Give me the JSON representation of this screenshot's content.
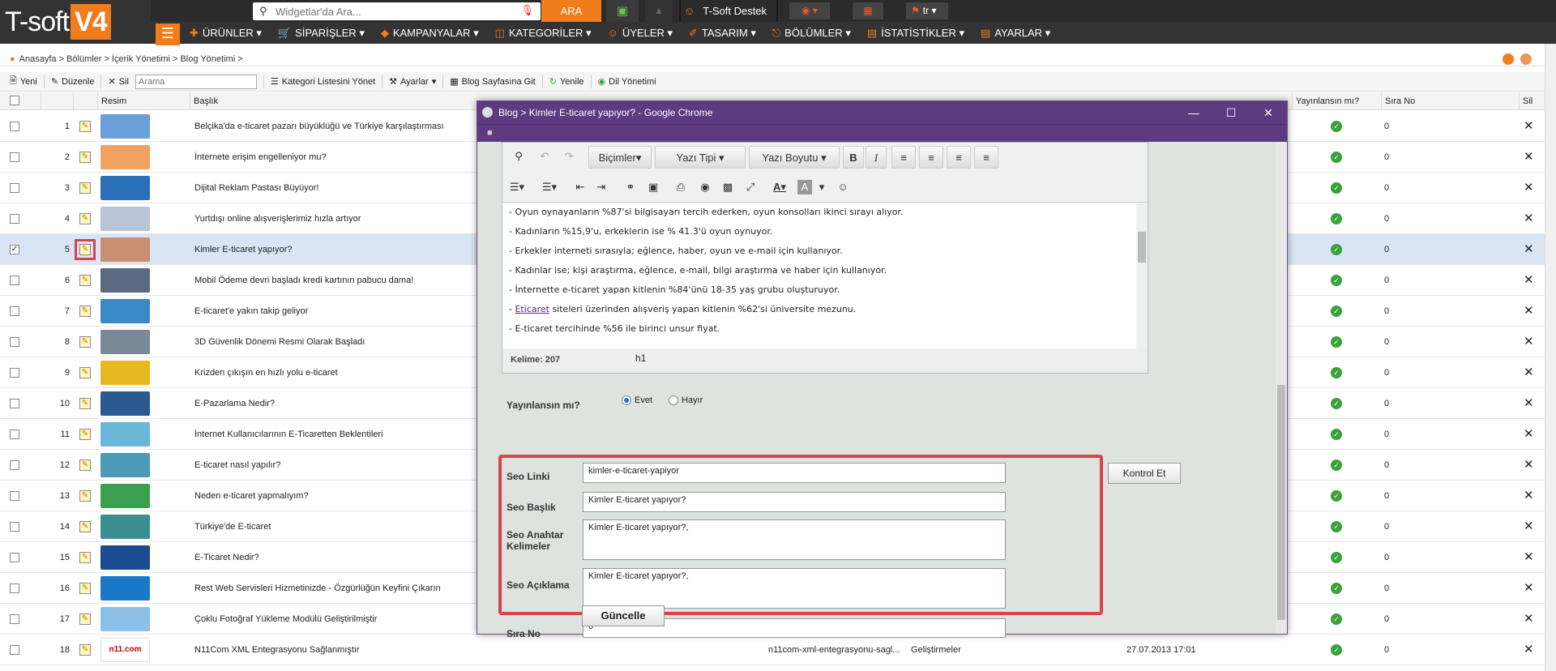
{
  "header": {
    "logo_text": "T-soft",
    "logo_version": "V4",
    "search_placeholder": "Widgetlar'da Ara...",
    "search_button": "ARA",
    "support_label": "T-Soft Destek",
    "language": "tr"
  },
  "nav": {
    "items": [
      {
        "label": "ÜRÜNLER",
        "icon": "plus-icon"
      },
      {
        "label": "SİPARİŞLER",
        "icon": "cart-icon"
      },
      {
        "label": "KAMPANYALAR",
        "icon": "tag-icon"
      },
      {
        "label": "KATEGORİLER",
        "icon": "tree-icon"
      },
      {
        "label": "ÜYELER",
        "icon": "users-icon"
      },
      {
        "label": "TASARIM",
        "icon": "brush-icon"
      },
      {
        "label": "BÖLÜMLER",
        "icon": "sitemap-icon"
      },
      {
        "label": "İSTATİSTİKLER",
        "icon": "chart-icon"
      },
      {
        "label": "AYARLAR",
        "icon": "settings-icon"
      }
    ]
  },
  "breadcrumb": "Anasayfa > Bölümler > İçerik Yönetimi > Blog Yönetimi >",
  "toolbar": {
    "new": "Yeni",
    "edit": "Düzenle",
    "delete": "Sil",
    "search_placeholder": "Arama",
    "category_manage": "Kategori Listesini Yönet",
    "settings": "Ayarlar",
    "goto_blog": "Blog Sayfasına Git",
    "refresh": "Yenile",
    "language_manage": "Dil Yönetimi"
  },
  "grid": {
    "headers": {
      "image": "Resim",
      "title": "Başlık",
      "published": "Yayınlansın mı?",
      "order": "Sıra No",
      "delete": "Sil"
    },
    "rows": [
      {
        "num": "1",
        "title": "Belçika'da e-ticaret pazarı büyüklüğü ve Türkiye karşılaştırması",
        "order": "0",
        "thumb": "#6a9fd8"
      },
      {
        "num": "2",
        "title": "İnternete erişim engelleniyor mu?",
        "order": "0",
        "thumb": "#f0a060"
      },
      {
        "num": "3",
        "title": "Dijital Reklam Pastası Büyüyor!",
        "order": "0",
        "thumb": "#2a6fb8"
      },
      {
        "num": "4",
        "title": "Yurtdışı online alışverişlerimiz hızla artıyor",
        "order": "0",
        "thumb": "#b8c4d8"
      },
      {
        "num": "5",
        "title": "Kimler E-ticaret yapıyor?",
        "order": "0",
        "thumb": "#c89070",
        "selected": true
      },
      {
        "num": "6",
        "title": "Mobil Ödeme devri başladı kredi kartının pabucu dama!",
        "order": "0",
        "thumb": "#5a6a80"
      },
      {
        "num": "7",
        "title": "E-ticaret'e yakın takip geliyor",
        "order": "0",
        "thumb": "#3a8ac8"
      },
      {
        "num": "8",
        "title": "3D Güvenlik Dönemi Resmi Olarak Başladı",
        "order": "0",
        "thumb": "#7a8898"
      },
      {
        "num": "9",
        "title": "Krizden çıkışın en hızlı yolu e-ticaret",
        "order": "0",
        "thumb": "#e8b820"
      },
      {
        "num": "10",
        "title": "E-Pazarlama Nedir?",
        "order": "0",
        "thumb": "#2a5a90"
      },
      {
        "num": "11",
        "title": "İnternet Kullanıcılarının E-Ticaretten Beklentileri",
        "order": "0",
        "thumb": "#6ab8d8"
      },
      {
        "num": "12",
        "title": "E-ticaret nasıl yapılır?",
        "order": "0",
        "thumb": "#4a9ab8"
      },
      {
        "num": "13",
        "title": "Neden e-ticaret yapmalıyım?",
        "order": "0",
        "thumb": "#3aa050"
      },
      {
        "num": "14",
        "title": "Türkiye'de E-ticaret",
        "order": "0",
        "thumb": "#3a9090"
      },
      {
        "num": "15",
        "title": "E-Ticaret Nedir?",
        "order": "0",
        "thumb": "#1a4a90"
      },
      {
        "num": "16",
        "title": "Rest Web Servisleri Hizmetinizde - Özgürlüğün Keyfini Çıkarın",
        "order": "0",
        "thumb": "#1a78c8"
      },
      {
        "num": "17",
        "title": "Çoklu Fotoğraf Yükleme Modülü Geliştirilmiştir",
        "order": "0",
        "thumb": "#8ac0e8"
      },
      {
        "num": "18",
        "title": "N11Com XML Entegrasyonu Sağlanmıştır",
        "order": "0",
        "thumb": "#ffffff",
        "thumb_text": "n11.com",
        "slug": "n11com-xml-entegrasyonu-sagl...",
        "category": "Geliştirmeler",
        "date": "27.07.2013 17:01"
      }
    ]
  },
  "window": {
    "title": "Blog > Kimler E-ticaret yapıyor? - Google Chrome",
    "editor": {
      "formats_label": "Biçimler",
      "font_label": "Yazı Tipi",
      "size_label": "Yazı Boyutu",
      "lines": [
        "- Oyun oynayanların %87'si bilgisayarı tercih ederken, oyun konsolları ikinci sırayı alıyor.",
        "- Kadınların %15,9'u, erkeklerin ise % 41.3'ü oyun oynuyor.",
        "- Erkekler interneti sırasıyla; eğlence, haber, oyun ve e-mail için kullanıyor.",
        "- Kadınlar ise; kişi araştırma, eğlence, e-mail, bilgi araştırma ve haber için kullanıyor.",
        "- İnternette e-ticaret yapan kitlenin %84'ünü 18-35 yaş grubu oluşturuyor."
      ],
      "line_link_prefix": "- ",
      "line_link_text": "Eticaret",
      "line_link_rest": " siteleri üzerinden alışveriş yapan kitlenin %62'si üniversite mezunu.",
      "last_line": "- E-ticaret tercihinde %56 ile birinci unsur fiyat.",
      "word_count": "Kelime: 207",
      "path_tag": "h1"
    },
    "form": {
      "publish_label": "Yayınlansın mı?",
      "yes": "Evet",
      "no": "Hayır",
      "seo_link_label": "Seo Linki",
      "seo_link_value": "kimler-e-ticaret-yapiyor",
      "check_button": "Kontrol Et",
      "seo_title_label": "Seo Başlık",
      "seo_title_value": "Kimler E-ticaret yapıyor?",
      "seo_keywords_label": "Seo Anahtar Kelimeler",
      "seo_keywords_value": "Kimler E-ticaret yapıyor?,",
      "seo_desc_label": "Seo Açıklama",
      "seo_desc_value": "Kimler E-ticaret yapıyor?,",
      "order_label": "Sıra No",
      "order_value": "0",
      "update_button": "Güncelle"
    }
  },
  "colors": {
    "accent": "#f07d1c",
    "window_title": "#5e3a80",
    "highlight": "#d9434c",
    "ok": "#3aa23a"
  }
}
